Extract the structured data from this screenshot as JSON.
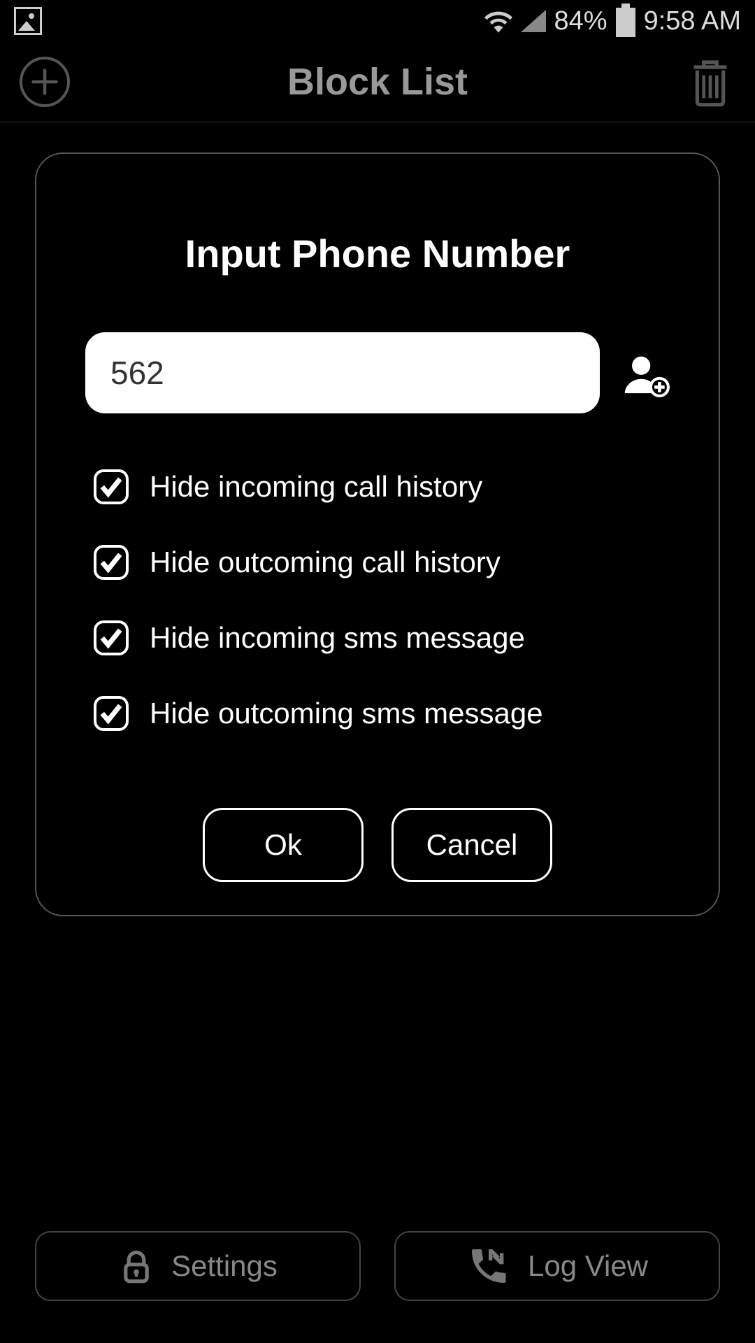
{
  "status": {
    "battery_pct": "84%",
    "time": "9:58 AM"
  },
  "header": {
    "title": "Block List"
  },
  "dialog": {
    "title": "Input Phone Number",
    "phone_value": "562",
    "options": [
      {
        "label": "Hide incoming call history",
        "checked": true
      },
      {
        "label": "Hide outcoming call history",
        "checked": true
      },
      {
        "label": "Hide incoming sms message",
        "checked": true
      },
      {
        "label": "Hide outcoming sms message",
        "checked": true
      }
    ],
    "ok_label": "Ok",
    "cancel_label": "Cancel"
  },
  "bottom": {
    "settings_label": "Settings",
    "logview_label": "Log View"
  }
}
